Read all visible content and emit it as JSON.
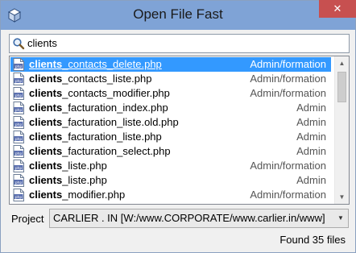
{
  "window": {
    "title": "Open File Fast",
    "close_glyph": "✕",
    "icon": "cube-icon"
  },
  "search": {
    "value": "clients",
    "icon": "magnifier-icon"
  },
  "results": [
    {
      "match": "clients",
      "rest": "_contacts_delete.php",
      "path": "Admin/formation",
      "selected": true
    },
    {
      "match": "clients",
      "rest": "_contacts_liste.php",
      "path": "Admin/formation",
      "selected": false
    },
    {
      "match": "clients",
      "rest": "_contacts_modifier.php",
      "path": "Admin/formation",
      "selected": false
    },
    {
      "match": "clients",
      "rest": "_facturation_index.php",
      "path": "Admin",
      "selected": false
    },
    {
      "match": "clients",
      "rest": "_facturation_liste.old.php",
      "path": "Admin",
      "selected": false
    },
    {
      "match": "clients",
      "rest": "_facturation_liste.php",
      "path": "Admin",
      "selected": false
    },
    {
      "match": "clients",
      "rest": "_facturation_select.php",
      "path": "Admin",
      "selected": false
    },
    {
      "match": "clients",
      "rest": "_liste.php",
      "path": "Admin/formation",
      "selected": false
    },
    {
      "match": "clients",
      "rest": "_liste.php",
      "path": "Admin",
      "selected": false
    },
    {
      "match": "clients",
      "rest": "_modifier.php",
      "path": "Admin/formation",
      "selected": false
    }
  ],
  "project": {
    "label": "Project",
    "value": "CARLIER . IN [W:/www.CORPORATE/www.carlier.in/www]"
  },
  "status": {
    "found": "Found 35 files"
  },
  "colors": {
    "titlebar": "#7fa3d6",
    "selection": "#3399ff",
    "close": "#c75050"
  }
}
